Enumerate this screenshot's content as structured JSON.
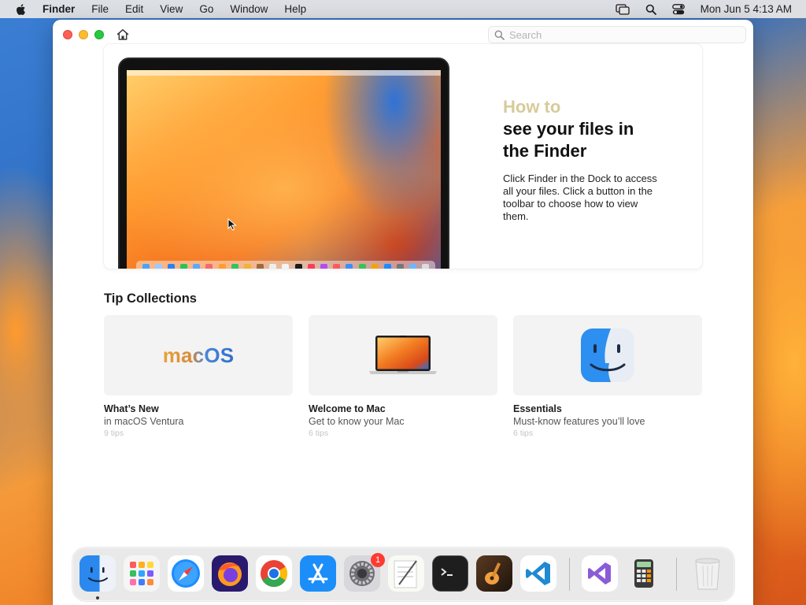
{
  "menubar": {
    "app_name": "Finder",
    "items": [
      "File",
      "Edit",
      "View",
      "Go",
      "Window",
      "Help"
    ],
    "clock": "Mon Jun 5  4:13 AM"
  },
  "window": {
    "search_placeholder": "Search"
  },
  "hero": {
    "eyebrow": "How to",
    "headline": "see your files in the Finder",
    "body": "Click Finder in the Dock to access all your files. Click a button in the toolbar to choose how to view them."
  },
  "tip_collections": {
    "title": "Tip Collections",
    "items": [
      {
        "thumb_word": "macOS",
        "title": "What’s New",
        "subtitle": "in macOS Ventura",
        "count": "9 tips"
      },
      {
        "title": "Welcome to Mac",
        "subtitle": "Get to know your Mac",
        "count": "6 tips"
      },
      {
        "title": "Essentials",
        "subtitle": "Must-know features you’ll love",
        "count": "6 tips"
      }
    ]
  },
  "dock": {
    "apps": [
      {
        "name": "finder-icon",
        "color": "#2f8ee8"
      },
      {
        "name": "launchpad-icon",
        "color": "#f0f0f0"
      },
      {
        "name": "safari-icon",
        "color": "#1a8cff"
      },
      {
        "name": "firefox-icon",
        "color": "#ff7a1a"
      },
      {
        "name": "chrome-icon",
        "color": "#ffffff"
      },
      {
        "name": "app-store-icon",
        "color": "#1c8ef9"
      },
      {
        "name": "system-settings-icon",
        "color": "#8e8e93"
      },
      {
        "name": "textedit-icon",
        "color": "#f7f7f2"
      },
      {
        "name": "terminal-icon",
        "color": "#1e1e1e"
      },
      {
        "name": "garageband-icon",
        "color": "#3a2a1e"
      },
      {
        "name": "vscode-icon",
        "color": "#ffffff"
      },
      {
        "name": "visual-studio-icon",
        "color": "#ffffff"
      },
      {
        "name": "calculator-icon",
        "color": "#e6e6e6"
      },
      {
        "name": "trash-icon",
        "color": "#e9e9e9"
      }
    ],
    "settings_badge": "1"
  },
  "colors": {
    "accent_blue": "#2f73d6",
    "eyebrow_gold": "#d7cb9a"
  }
}
